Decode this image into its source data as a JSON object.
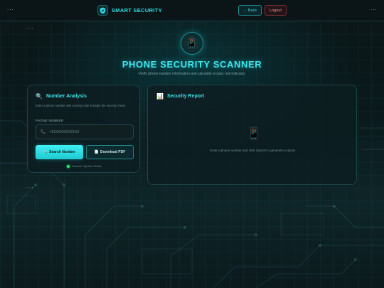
{
  "topbar": {
    "brand": "SMART SECURITY",
    "back_label": "← Back",
    "logout_label": "Logout",
    "dots": "..."
  },
  "hero": {
    "icon": "📱",
    "icon_name": "mobile-phone-icon",
    "title": "PHONE SECURITY SCANNER",
    "subtitle": "Verify phone number information and calculate a basic risk indicator."
  },
  "analysis": {
    "icon": "🔍",
    "title": "Number Analysis",
    "hint": "Enter a phone number with country code to begin the security check.",
    "field_label": "PHONE NUMBER",
    "input_icon": "📞",
    "input_placeholder": "+91XXXXXXXXXX",
    "input_value": "",
    "search_icon": "🔍",
    "search_label": "Search Number",
    "pdf_icon": "📄",
    "pdf_label": "Download PDF",
    "status_text": "Scanner System Online"
  },
  "report": {
    "icon": "📊",
    "title": "Security Report",
    "empty_icon": "📱",
    "empty_message": "Enter a phone number and click Search to generate a report."
  },
  "colors": {
    "accent": "#3ee6ec",
    "online": "#2ee27a",
    "logout": "#ff8b95"
  }
}
